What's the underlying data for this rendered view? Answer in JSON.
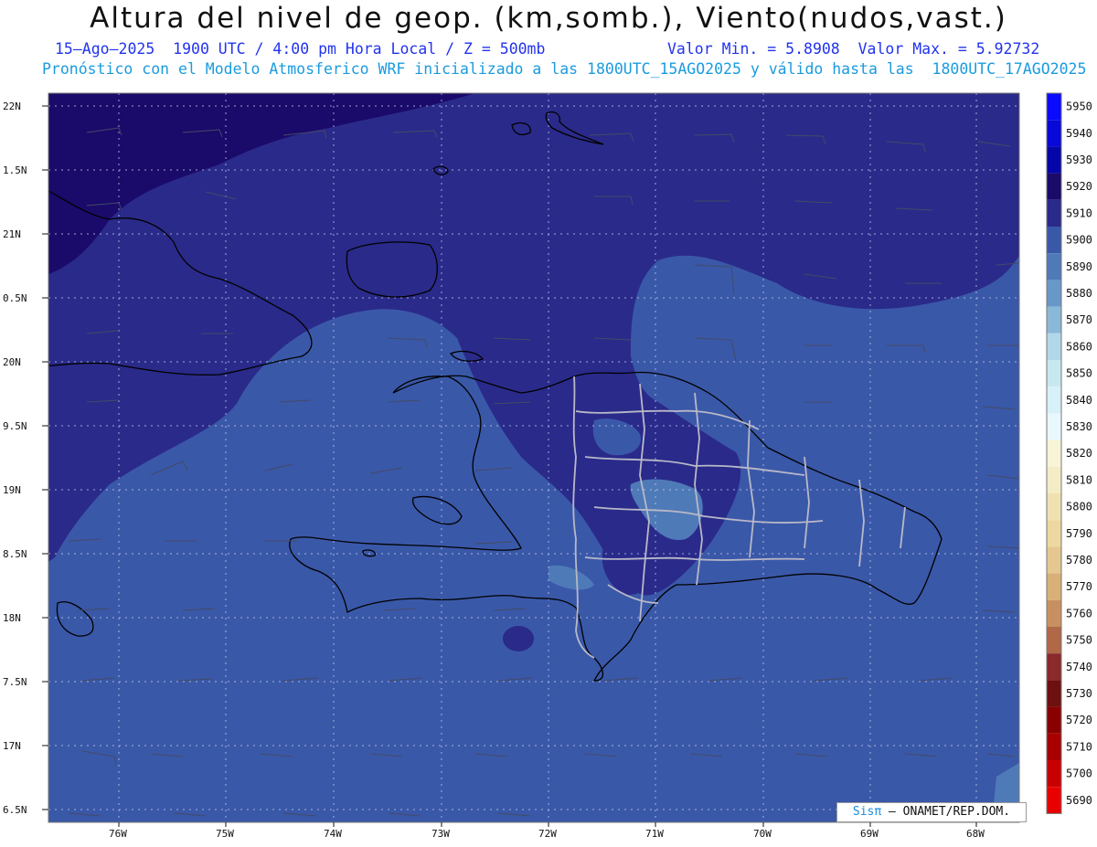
{
  "header": {
    "title": "Altura del nivel de geop. (km,somb.), Viento(nudos,vast.)",
    "line1_left": "15–Ago–2025  1900 UTC / 4:00 pm Hora Local / Z = 500mb",
    "line1_right": "Valor Min. = 5.8908  Valor Max. = 5.92732",
    "line2": "Pronóstico con el Modelo Atmosferico WRF inicializado a las 1800UTC_15AGO2025 y válido hasta las  1800UTC_17AGO2025"
  },
  "axes": {
    "lat_labels": [
      "22N",
      "1.5N",
      "21N",
      "0.5N",
      "20N",
      "9.5N",
      "19N",
      "8.5N",
      "18N",
      "7.5N",
      "17N",
      "6.5N"
    ],
    "lon_labels": [
      "76W",
      "75W",
      "74W",
      "73W",
      "72W",
      "71W",
      "70W",
      "69W",
      "68W"
    ]
  },
  "colorbar": {
    "labels": [
      "5950",
      "5940",
      "5930",
      "5920",
      "5910",
      "5900",
      "5890",
      "5880",
      "5870",
      "5860",
      "5850",
      "5840",
      "5830",
      "5820",
      "5810",
      "5800",
      "5790",
      "5780",
      "5770",
      "5760",
      "5750",
      "5740",
      "5730",
      "5720",
      "5710",
      "5700",
      "5690"
    ],
    "colors": [
      "#0a0aff",
      "#0808d8",
      "#0606a8",
      "#1a0a6a",
      "#2a2a8a",
      "#3a58a8",
      "#4f7ab8",
      "#6898c8",
      "#8ab8d8",
      "#b0d8e8",
      "#c8e8f0",
      "#d8f0f8",
      "#e8f8fc",
      "#f8f4d8",
      "#f4ecc4",
      "#f0e2b0",
      "#ecd8a0",
      "#e4c890",
      "#d8b078",
      "#c89060",
      "#b06848",
      "#8a2a2a",
      "#6e1010",
      "#8a0000",
      "#a80000",
      "#c80000",
      "#e80000"
    ]
  },
  "credit": {
    "brand": "Sisπ",
    "text": " – ONAMET/REP.DOM."
  }
}
